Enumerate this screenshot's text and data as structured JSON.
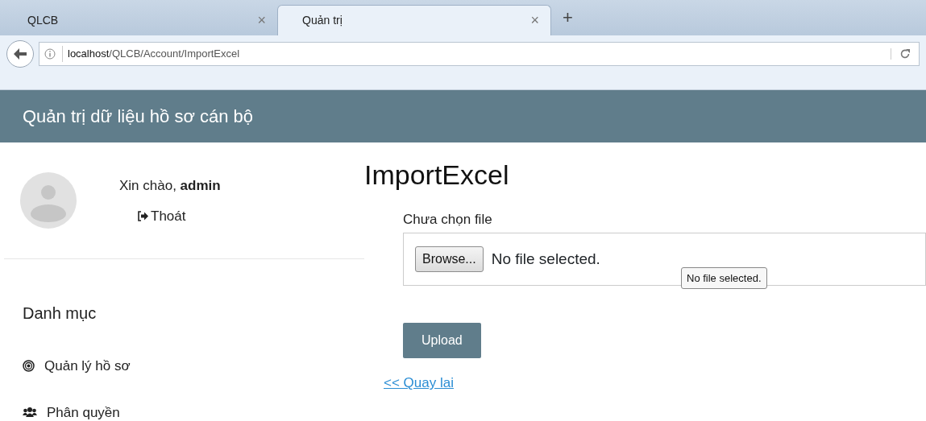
{
  "browser": {
    "tabs": [
      {
        "title": "QLCB",
        "close": "×",
        "selected": false
      },
      {
        "title": "Quản trị",
        "close": "×",
        "selected": true
      }
    ],
    "new_tab": "+",
    "url_host": "localhost",
    "url_path": "/QLCB/Account/ImportExcel"
  },
  "header": {
    "title": "Quản trị dữ liệu hồ sơ cán bộ"
  },
  "user": {
    "greeting": "Xin chào, **admin**",
    "logout": "Thoát"
  },
  "sidebar": {
    "heading": "Danh mục",
    "items": [
      {
        "label": "Quản lý hồ sơ",
        "kind": "target"
      },
      {
        "label": "Phân quyền",
        "kind": "users"
      }
    ]
  },
  "page": {
    "title": "ImportExcel",
    "file_label": "Chưa chọn file",
    "browse": "Browse...",
    "file_status": "No file selected.",
    "tooltip": "No file selected.",
    "upload": "Upload",
    "back_link": "<< Quay lai"
  }
}
